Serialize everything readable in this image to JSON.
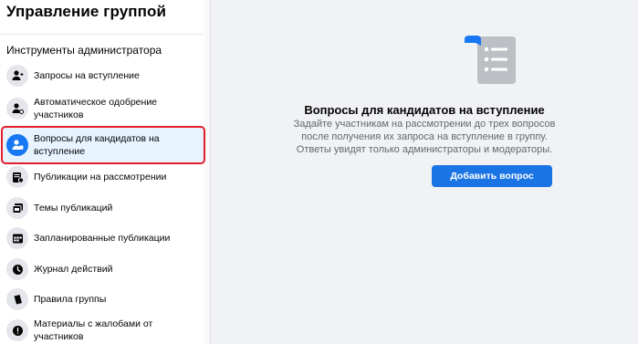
{
  "sidebar": {
    "title": "Управление группой",
    "section_label": "Инструменты администратора",
    "items": [
      {
        "label": "Запросы на вступление",
        "icon": "person-add-icon"
      },
      {
        "label": "Автоматическое одобрение участников",
        "icon": "person-check-icon"
      },
      {
        "label": "Вопросы для кандидатов на вступление",
        "icon": "person-question-icon",
        "active": true
      },
      {
        "label": "Публикации на рассмотрении",
        "icon": "pending-posts-icon"
      },
      {
        "label": "Темы публикаций",
        "icon": "post-topics-icon"
      },
      {
        "label": "Запланированные публикации",
        "icon": "calendar-icon"
      },
      {
        "label": "Журнал действий",
        "icon": "clock-icon"
      },
      {
        "label": "Правила группы",
        "icon": "book-icon"
      },
      {
        "label": "Материалы с жалобами от участников",
        "icon": "alert-icon"
      }
    ]
  },
  "main": {
    "title": "Вопросы для кандидатов на вступление",
    "description_lines": [
      "Задайте участникам на рассмотрении до трех вопросов",
      "после получения их запроса на вступление в группу.",
      "Ответы увидят только администраторы и модераторы."
    ],
    "button_label": "Добавить вопрос"
  },
  "colors": {
    "accent": "#1b74e4",
    "active_bg": "#e7f3ff",
    "highlight_border": "#e41e2b",
    "page_bg": "#f0f2f5",
    "secondary_text": "#65676b"
  }
}
